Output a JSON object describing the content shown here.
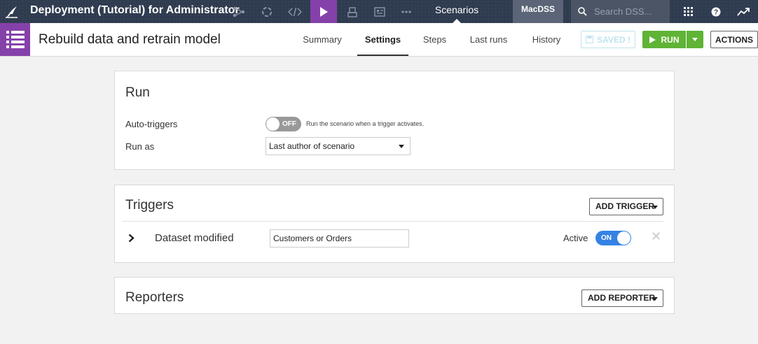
{
  "topbar": {
    "project_title": "Deployment (Tutorial) for Administrator",
    "nav_current": "Scenarios",
    "instance": "MacDSS",
    "search_placeholder": "Search DSS..."
  },
  "subheader": {
    "title": "Rebuild data and retrain model",
    "tabs": [
      {
        "label": "Summary"
      },
      {
        "label": "Settings",
        "active": true
      },
      {
        "label": "Steps"
      },
      {
        "label": "Last runs"
      },
      {
        "label": "History"
      }
    ],
    "saved_label": "SAVED !",
    "run_label": "RUN",
    "actions_label": "ACTIONS"
  },
  "run_panel": {
    "title": "Run",
    "auto_triggers_label": "Auto-triggers",
    "auto_triggers_state": "OFF",
    "auto_triggers_hint": "Run the scenario when a trigger activates.",
    "run_as_label": "Run as",
    "run_as_value": "Last author of scenario"
  },
  "triggers_panel": {
    "title": "Triggers",
    "add_label": "ADD TRIGGER",
    "trigger": {
      "name": "Dataset modified",
      "datasets_value": "Customers or Orders",
      "active_label": "Active",
      "active_state": "ON"
    }
  },
  "reporters_panel": {
    "title": "Reporters",
    "add_label": "ADD REPORTER"
  },
  "colors": {
    "accent_purple": "#8541aa",
    "run_green": "#5fb335",
    "toggle_on_blue": "#3582e4",
    "navbar": "#2f3b4f"
  }
}
